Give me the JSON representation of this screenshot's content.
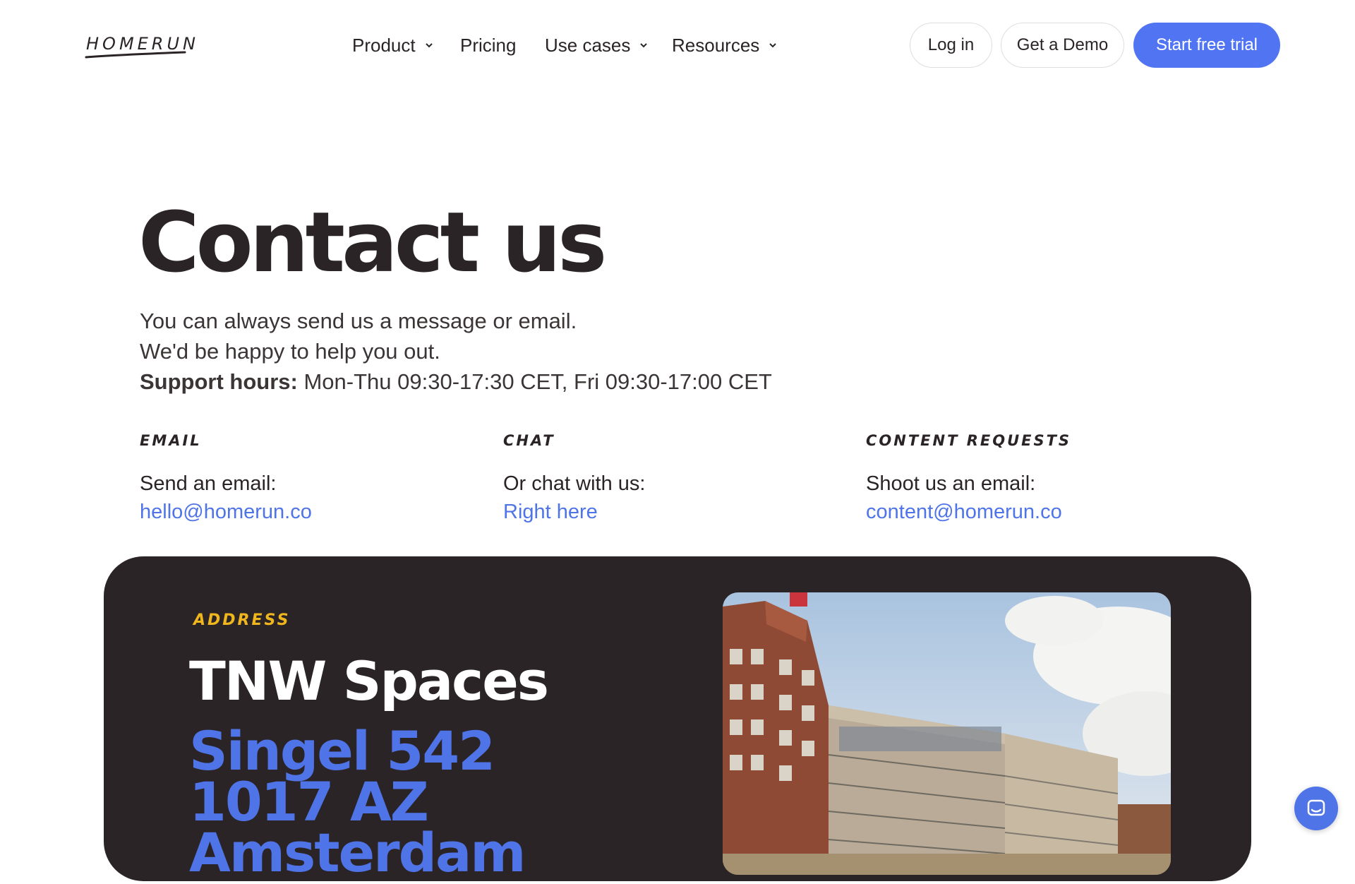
{
  "brand": {
    "logo_text": "HOMERUN",
    "accent": "#5174f3",
    "link": "#4f74e8",
    "dark": "#2b2426",
    "address_kicker_color": "#f0b61d"
  },
  "nav": {
    "items": [
      {
        "label": "Product",
        "has_dropdown": true
      },
      {
        "label": "Pricing",
        "has_dropdown": false
      },
      {
        "label": "Use cases",
        "has_dropdown": true
      },
      {
        "label": "Resources",
        "has_dropdown": true
      }
    ],
    "login": "Log in",
    "demo": "Get a Demo",
    "trial": "Start free trial"
  },
  "hero": {
    "title": "Contact us",
    "line1": "You can always send us a message or email.",
    "line2": "We'd be happy to help you out.",
    "support_label": "Support hours:",
    "support_hours": "Mon-Thu 09:30-17:30 CET, Fri 09:30-17:00 CET"
  },
  "contacts": [
    {
      "heading": "Email",
      "label": "Send an email:",
      "link": "hello@homerun.co"
    },
    {
      "heading": "Chat",
      "label": "Or chat with us:",
      "link": "Right here"
    },
    {
      "heading": "Content requests",
      "label": "Shoot us an email:",
      "link": "content@homerun.co"
    }
  ],
  "address": {
    "kicker": "Address",
    "name": "TNW Spaces",
    "street": "Singel 542",
    "postcode": "1017 AZ",
    "city": "Amsterdam"
  },
  "icons": {
    "chat_launcher": "chat-bubble-icon",
    "dropdown": "chevron-down-icon"
  }
}
